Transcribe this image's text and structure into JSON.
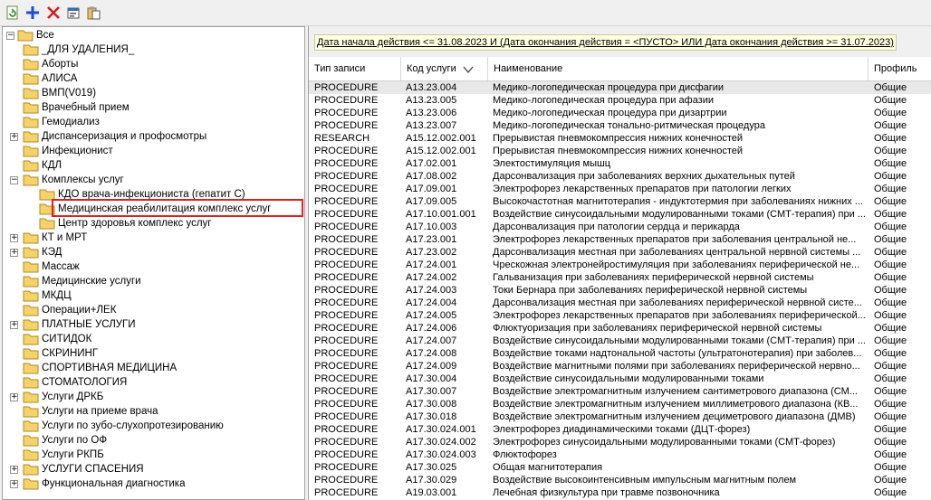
{
  "toolbar": {
    "buttons": [
      {
        "name": "refresh-icon"
      },
      {
        "name": "add-icon"
      },
      {
        "name": "delete-icon"
      },
      {
        "name": "properties-icon"
      },
      {
        "name": "paste-icon"
      }
    ]
  },
  "tree": {
    "root": "Все",
    "items": [
      {
        "label": "_ДЛЯ УДАЛЕНИЯ_",
        "expander": ""
      },
      {
        "label": "Аборты",
        "expander": ""
      },
      {
        "label": "АЛИСА",
        "expander": ""
      },
      {
        "label": "ВМП(V019)",
        "expander": ""
      },
      {
        "label": "Врачебный прием",
        "expander": ""
      },
      {
        "label": "Гемодиализ",
        "expander": ""
      },
      {
        "label": "Диспансеризация и профосмотры",
        "expander": "+"
      },
      {
        "label": "Инфекционист",
        "expander": ""
      },
      {
        "label": "КДЛ",
        "expander": ""
      },
      {
        "label": "Комплексы услуг",
        "expander": "−"
      },
      {
        "label": "КДО врача-инфекциониста (гепатит С)",
        "expander": "",
        "child": true
      },
      {
        "label": "Медицинская реабилитация комплекс услуг",
        "expander": "",
        "child": true,
        "selected": true
      },
      {
        "label": "Центр здоровья комплекс услуг",
        "expander": "",
        "child": true
      },
      {
        "label": "КТ и МРТ",
        "expander": "+"
      },
      {
        "label": "КЭД",
        "expander": "+"
      },
      {
        "label": "Массаж",
        "expander": ""
      },
      {
        "label": "Медицинские услуги",
        "expander": ""
      },
      {
        "label": "МКДЦ",
        "expander": ""
      },
      {
        "label": "Операции+ЛЕК",
        "expander": ""
      },
      {
        "label": "ПЛАТНЫЕ УСЛУГИ",
        "expander": "+"
      },
      {
        "label": "СИТИДОК",
        "expander": ""
      },
      {
        "label": "СКРИНИНГ",
        "expander": ""
      },
      {
        "label": "СПОРТИВНАЯ МЕДИЦИНА",
        "expander": ""
      },
      {
        "label": "СТОМАТОЛОГИЯ",
        "expander": ""
      },
      {
        "label": "Услуги ДРКБ",
        "expander": "+"
      },
      {
        "label": "Услуги на приеме врача",
        "expander": ""
      },
      {
        "label": "Услуги по зубо-слухопротезированию",
        "expander": ""
      },
      {
        "label": "Услуги по ОФ",
        "expander": ""
      },
      {
        "label": "Услуги РКПБ",
        "expander": ""
      },
      {
        "label": "УСЛУГИ СПАСЕНИЯ",
        "expander": "+"
      },
      {
        "label": "Функциональная диагностика",
        "expander": "+"
      }
    ]
  },
  "filter": {
    "text": "Дата начала действия <= 31.08.2023 И (Дата окончания действия = <ПУСТО> ИЛИ Дата окончания действия >= 31.07.2023)"
  },
  "grid": {
    "headers": {
      "type": "Тип записи",
      "code": "Код услуги",
      "name": "Наименование",
      "profile": "Профиль"
    },
    "rows": [
      [
        "PROCEDURE",
        "A13.23.004",
        "Медико-логопедическая процедура при дисфагии",
        "Общие"
      ],
      [
        "PROCEDURE",
        "A13.23.005",
        "Медико-логопедическая процедура при афазии",
        "Общие"
      ],
      [
        "PROCEDURE",
        "A13.23.006",
        "Медико-логопедическая процедура при дизартрии",
        "Общие"
      ],
      [
        "PROCEDURE",
        "A13.23.007",
        "Медико-логопедическая тонально-ритмическая процедура",
        "Общие"
      ],
      [
        "RESEARCH",
        "A15.12.002.001",
        "Прерывистая пневмокомпрессия нижних конечностей",
        "Общие"
      ],
      [
        "PROCEDURE",
        "A15.12.002.001",
        "Прерывистая пневмокомпрессия нижних конечностей",
        "Общие"
      ],
      [
        "PROCEDURE",
        "A17.02.001",
        "Электостимуляция мышц",
        "Общие"
      ],
      [
        "PROCEDURE",
        "A17.08.002",
        "Дарсонвализация при заболеваниях верхних дыхательных путей",
        "Общие"
      ],
      [
        "PROCEDURE",
        "A17.09.001",
        "Электрофорез лекарственных препаратов при патологии легких",
        "Общие"
      ],
      [
        "PROCEDURE",
        "A17.09.005",
        "Высокочастотная магнитотерапия - индуктотермия при заболеваниях нижних ...",
        "Общие"
      ],
      [
        "PROCEDURE",
        "A17.10.001.001",
        "Воздействие синусоидальными модулированными токами (СМТ-терапия) при ...",
        "Общие"
      ],
      [
        "PROCEDURE",
        "A17.10.003",
        "Дарсонвализация при патологии сердца и перикарда",
        "Общие"
      ],
      [
        "PROCEDURE",
        "A17.23.001",
        "Электрофорез лекарственных препаратов при заболевания центральной не...",
        "Общие"
      ],
      [
        "PROCEDURE",
        "A17.23.002",
        "Дарсонвализация местная при заболеваниях центральной нервной системы ...",
        "Общие"
      ],
      [
        "PROCEDURE",
        "A17.24.001",
        "Чрескожная электронейростимуляция при заболеваниях периферической не...",
        "Общие"
      ],
      [
        "PROCEDURE",
        "A17.24.002",
        "Гальванизация при заболеваниях периферической нервной системы",
        "Общие"
      ],
      [
        "PROCEDURE",
        "A17.24.003",
        "Токи Бернара при заболеваниях периферической нервной системы",
        "Общие"
      ],
      [
        "PROCEDURE",
        "A17.24.004",
        "Дарсонвализация местная при заболеваниях периферической нервной систе...",
        "Общие"
      ],
      [
        "PROCEDURE",
        "A17.24.005",
        "Электрофорез лекарственных препаратов при заболеваниях периферической...",
        "Общие"
      ],
      [
        "PROCEDURE",
        "A17.24.006",
        "Флюктуоризация при заболеваниях периферической нервной системы",
        "Общие"
      ],
      [
        "PROCEDURE",
        "A17.24.007",
        "Воздействие синусоидальными модулированными токами (СМТ-терапия) при ...",
        "Общие"
      ],
      [
        "PROCEDURE",
        "A17.24.008",
        "Воздействие токами надтональной частоты (ультратонотерапия) при заболев...",
        "Общие"
      ],
      [
        "PROCEDURE",
        "A17.24.009",
        "Воздействие магнитными полями при заболеваниях периферической нервно...",
        "Общие"
      ],
      [
        "PROCEDURE",
        "A17.30.004",
        "Воздействие синусоидальными модулированными токами",
        "Общие"
      ],
      [
        "PROCEDURE",
        "A17.30.007",
        "Воздействие электромагнитным излучением сантиметрового диапазона (СМ...",
        "Общие"
      ],
      [
        "PROCEDURE",
        "A17.30.008",
        "Воздействие электромагнитным излучением миллиметрового диапазона (КВ...",
        "Общие"
      ],
      [
        "PROCEDURE",
        "A17.30.018",
        "Воздействие электромагнитным излучением дециметрового диапазона (ДМВ)",
        "Общие"
      ],
      [
        "PROCEDURE",
        "A17.30.024.001",
        "Электрофорез диадинамическими токами (ДЦТ-форез)",
        "Общие"
      ],
      [
        "PROCEDURE",
        "A17.30.024.002",
        "Электрофорез синусоидальными модулированными токами (СМТ-форез)",
        "Общие"
      ],
      [
        "PROCEDURE",
        "A17.30.024.003",
        "Флюктофорез",
        "Общие"
      ],
      [
        "PROCEDURE",
        "A17.30.025",
        "Общая магнитотерапия",
        "Общие"
      ],
      [
        "PROCEDURE",
        "A17.30.029",
        "Воздействие высокоинтенсивным импульсным магнитным полем",
        "Общие"
      ],
      [
        "PROCEDURE",
        "A19.03.001",
        "Лечебная физкультура при травме позвоночника",
        "Общие"
      ]
    ]
  }
}
